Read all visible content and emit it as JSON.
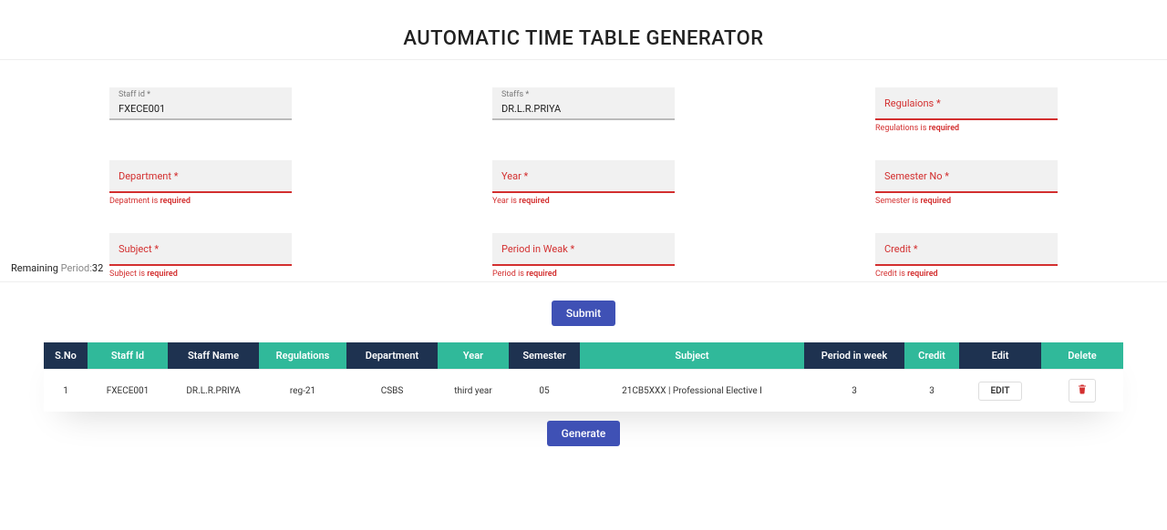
{
  "title": "AUTOMATIC TIME TABLE GENERATOR",
  "form": {
    "staff_id": {
      "label": "Staff id *",
      "value": "FXECE001",
      "error": ""
    },
    "staffs": {
      "label": "Staffs *",
      "value": "DR.L.R.PRIYA",
      "error": ""
    },
    "regulations": {
      "label": "Regulaions *",
      "value": "",
      "error_prefix": "Regulations is ",
      "error_word": "required"
    },
    "department": {
      "label": "Department *",
      "value": "",
      "error_prefix": "Depatment is ",
      "error_word": "required"
    },
    "year": {
      "label": "Year *",
      "value": "",
      "error_prefix": "Year is ",
      "error_word": "required"
    },
    "semester": {
      "label": "Semester No *",
      "value": "",
      "error_prefix": "Semester is ",
      "error_word": "required"
    },
    "subject": {
      "label": "Subject *",
      "value": "",
      "error_prefix": "Subject is ",
      "error_word": "required"
    },
    "period": {
      "label": "Period in Weak *",
      "value": "",
      "error_prefix": "Period is ",
      "error_word": "required"
    },
    "credit": {
      "label": "Credit *",
      "value": "",
      "error_prefix": "Credit is ",
      "error_word": "required"
    }
  },
  "remaining": {
    "label": "Remaining ",
    "muted": "Period:",
    "value": "32"
  },
  "buttons": {
    "submit": "Submit",
    "generate": "Generate",
    "edit": "EDIT"
  },
  "table": {
    "headers": [
      "S.No",
      "Staff Id",
      "Staff Name",
      "Regulations",
      "Department",
      "Year",
      "Semester",
      "Subject",
      "Period in week",
      "Credit",
      "Edit",
      "Delete"
    ],
    "row": {
      "sno": "1",
      "staff_id": "FXECE001",
      "staff_name": "DR.L.R.PRIYA",
      "regulations": "reg-21",
      "department": "CSBS",
      "year": "third year",
      "semester": "05",
      "subject": "21CB5XXX | Professional Elective I",
      "period": "3",
      "credit": "3"
    }
  }
}
